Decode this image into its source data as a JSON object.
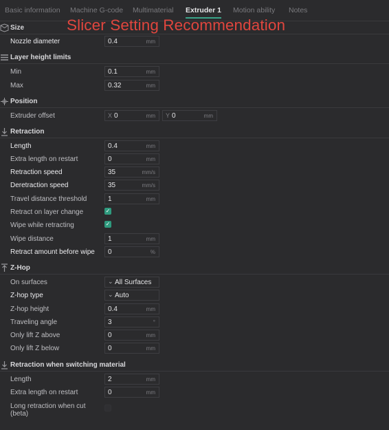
{
  "tabs": [
    "Basic information",
    "Machine G-code",
    "Multimaterial",
    "Extruder 1",
    "Motion ability",
    "Notes"
  ],
  "active_tab": "Extruder 1",
  "overlay_title": "Slicer Setting Recommendation",
  "sections": {
    "size": {
      "title": "Size",
      "icon": "size-icon",
      "nozzle_diameter": {
        "label": "Nozzle diameter",
        "value": "0.4",
        "unit": "mm"
      }
    },
    "layer_height": {
      "title": "Layer height limits",
      "icon": "layers-icon",
      "min": {
        "label": "Min",
        "value": "0.1",
        "unit": "mm"
      },
      "max": {
        "label": "Max",
        "value": "0.32",
        "unit": "mm"
      }
    },
    "position": {
      "title": "Position",
      "icon": "position-icon",
      "extruder_offset": {
        "label": "Extruder offset",
        "x_axis": "X",
        "x_value": "0",
        "y_axis": "Y",
        "y_value": "0",
        "unit": "mm"
      }
    },
    "retraction": {
      "title": "Retraction",
      "icon": "retraction-icon",
      "length": {
        "label": "Length",
        "value": "0.4",
        "unit": "mm"
      },
      "extra_length": {
        "label": "Extra length on restart",
        "value": "0",
        "unit": "mm"
      },
      "retraction_speed": {
        "label": "Retraction speed",
        "value": "35",
        "unit": "mm/s"
      },
      "deretraction_speed": {
        "label": "Deretraction speed",
        "value": "35",
        "unit": "mm/s"
      },
      "travel_threshold": {
        "label": "Travel distance threshold",
        "value": "1",
        "unit": "mm"
      },
      "retract_layer_change": {
        "label": "Retract on layer change",
        "checked": true
      },
      "wipe_retracting": {
        "label": "Wipe while retracting",
        "checked": true
      },
      "wipe_distance": {
        "label": "Wipe distance",
        "value": "1",
        "unit": "mm"
      },
      "retract_before_wipe": {
        "label": "Retract amount before wipe",
        "value": "0",
        "unit": "%"
      }
    },
    "zhop": {
      "title": "Z-Hop",
      "icon": "zhop-icon",
      "on_surfaces": {
        "label": "On surfaces",
        "value": "All Surfaces"
      },
      "zhop_type": {
        "label": "Z-hop type",
        "value": "Auto"
      },
      "zhop_height": {
        "label": "Z-hop height",
        "value": "0.4",
        "unit": "mm"
      },
      "traveling_angle": {
        "label": "Traveling angle",
        "value": "3",
        "unit": "°"
      },
      "lift_above": {
        "label": "Only lift Z above",
        "value": "0",
        "unit": "mm"
      },
      "lift_below": {
        "label": "Only lift Z below",
        "value": "0",
        "unit": "mm"
      }
    },
    "switching": {
      "title": "Retraction when switching material",
      "icon": "switch-material-icon",
      "length": {
        "label": "Length",
        "value": "2",
        "unit": "mm"
      },
      "extra_length": {
        "label": "Extra length on restart",
        "value": "0",
        "unit": "mm"
      },
      "long_retraction": {
        "label": "Long retraction when cut",
        "label2": "(beta)",
        "checked": false
      }
    }
  },
  "colors": {
    "accent": "#3aa58a",
    "overlay": "#e0463e",
    "background": "#2b2b2d"
  }
}
